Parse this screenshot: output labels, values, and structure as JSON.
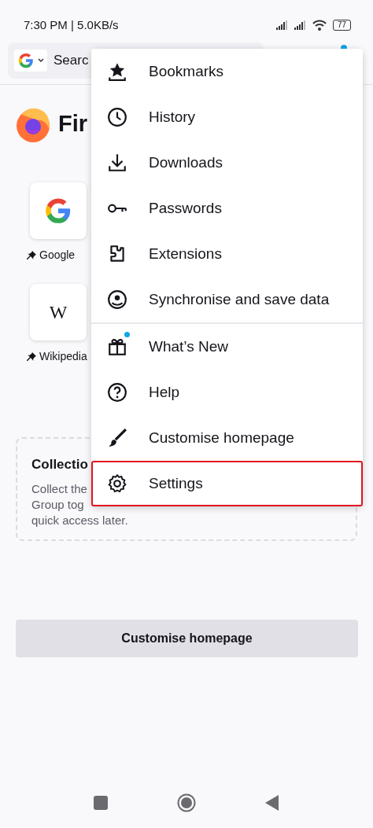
{
  "status_bar": {
    "time_speed": "7:30 PM | 5.0KB/s",
    "battery": "77"
  },
  "toolbar": {
    "search_placeholder": "Searc",
    "menu_badge": true
  },
  "home": {
    "brand": "Fir",
    "shortcuts": [
      {
        "kind": "google",
        "label": "Google",
        "pinned": true
      },
      {
        "kind": "letter",
        "tile": "W",
        "label": "Wikipedia",
        "pinned": true
      }
    ],
    "collections": {
      "title": "Collectio",
      "lines": [
        "Collect the",
        "Group tog",
        "quick access later."
      ]
    },
    "customise_button": "Customise homepage"
  },
  "menu": {
    "sections": [
      {
        "items": [
          {
            "label": "Bookmarks",
            "badge": false,
            "highlighted": false
          },
          {
            "label": "History",
            "badge": false,
            "highlighted": false
          },
          {
            "label": "Downloads",
            "badge": false,
            "highlighted": false
          },
          {
            "label": "Passwords",
            "badge": false,
            "highlighted": false
          },
          {
            "label": "Extensions",
            "badge": false,
            "highlighted": false
          },
          {
            "label": "Synchronise and save data",
            "badge": false,
            "highlighted": false
          }
        ]
      },
      {
        "items": [
          {
            "label": "What’s New",
            "badge": true,
            "highlighted": false
          },
          {
            "label": "Help",
            "badge": false,
            "highlighted": false
          },
          {
            "label": "Customise homepage",
            "badge": false,
            "highlighted": false
          },
          {
            "label": "Settings",
            "badge": false,
            "highlighted": true
          }
        ]
      }
    ]
  }
}
